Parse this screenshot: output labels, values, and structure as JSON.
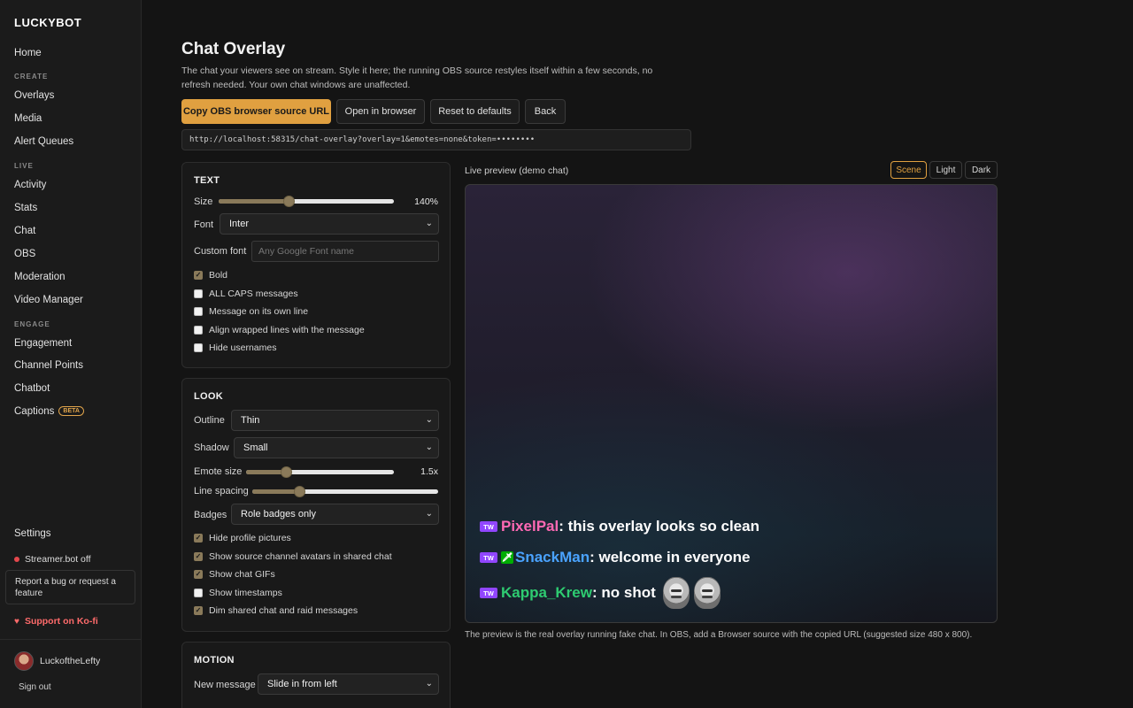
{
  "sidebar": {
    "brand": "LUCKYBOT",
    "home": "Home",
    "create_section": "CREATE",
    "overlays": "Overlays",
    "media": "Media",
    "alert_queues": "Alert Queues",
    "live_section": "LIVE",
    "activity": "Activity",
    "stats": "Stats",
    "chat": "Chat",
    "obs": "OBS",
    "moderation": "Moderation",
    "video_manager": "Video Manager",
    "engage_section": "ENGAGE",
    "engagement": "Engagement",
    "channel_points": "Channel Points",
    "chatbot": "Chatbot",
    "captions": "Captions",
    "captions_badge": "BETA",
    "settings": "Settings",
    "streamerbot_status": "Streamer.bot off",
    "report_bug": "Report a bug or request a feature",
    "kofi": "Support on Ko-fi",
    "username": "LuckoftheLefty",
    "sign_out": "Sign out"
  },
  "page": {
    "title": "Chat Overlay",
    "description": "The chat your viewers see on stream. Style it here; the running OBS source restyles itself within a few seconds, no refresh needed. Your own chat windows are unaffected.",
    "copy_button": "Copy OBS browser source URL",
    "open_button": "Open in browser",
    "reset_button": "Reset to defaults",
    "back_button": "Back",
    "url": "http://localhost:58315/chat-overlay?overlay=1&emotes=none&token=••••••••"
  },
  "text_card": {
    "title": "TEXT",
    "size_label": "Size",
    "size_value": "140%",
    "size_level": 0.4,
    "font_label": "Font",
    "font_value": "Inter",
    "custom_font_label": "Custom font",
    "custom_font_placeholder": "Any Google Font name",
    "checks": [
      {
        "label": "Bold",
        "checked": true
      },
      {
        "label": "ALL CAPS messages",
        "checked": false
      },
      {
        "label": "Message on its own line",
        "checked": false
      },
      {
        "label": "Align wrapped lines with the message",
        "checked": false
      },
      {
        "label": "Hide usernames",
        "checked": false
      }
    ]
  },
  "look_card": {
    "title": "LOOK",
    "outline_label": "Outline",
    "outline_value": "Thin",
    "shadow_label": "Shadow",
    "shadow_value": "Small",
    "emote_size_label": "Emote size",
    "emote_size_value": "1.5x",
    "emote_size_level": 0.27,
    "line_spacing_label": "Line spacing",
    "line_spacing_level": 0.25,
    "badges_label": "Badges",
    "badges_value": "Role badges only",
    "checks": [
      {
        "label": "Hide profile pictures",
        "checked": true
      },
      {
        "label": "Show source channel avatars in shared chat",
        "checked": true
      },
      {
        "label": "Show chat GIFs",
        "checked": true
      },
      {
        "label": "Show timestamps",
        "checked": false
      },
      {
        "label": "Dim shared chat and raid messages",
        "checked": true
      }
    ]
  },
  "motion_card": {
    "title": "MOTION",
    "new_message_label": "New message",
    "new_message_value": "Slide in from left"
  },
  "preview": {
    "label": "Live preview (demo chat)",
    "modes": [
      "Scene",
      "Light",
      "Dark"
    ],
    "active_mode": "Scene",
    "badge_text": "TW",
    "mod_badge_glyph": "🗡",
    "messages": [
      {
        "user": "PixelPal",
        "color": "#ff69b4",
        "text": "this overlay looks so clean"
      },
      {
        "user": "SnackMan",
        "color": "#4aa3ff",
        "text": "welcome in everyone"
      },
      {
        "user": "Kappa_Krew",
        "color": "#2ecc71",
        "text": "no shot"
      }
    ],
    "caption": "The preview is the real overlay running fake chat. In OBS, add a Browser source with the copied URL (suggested size 480 x 800)."
  }
}
